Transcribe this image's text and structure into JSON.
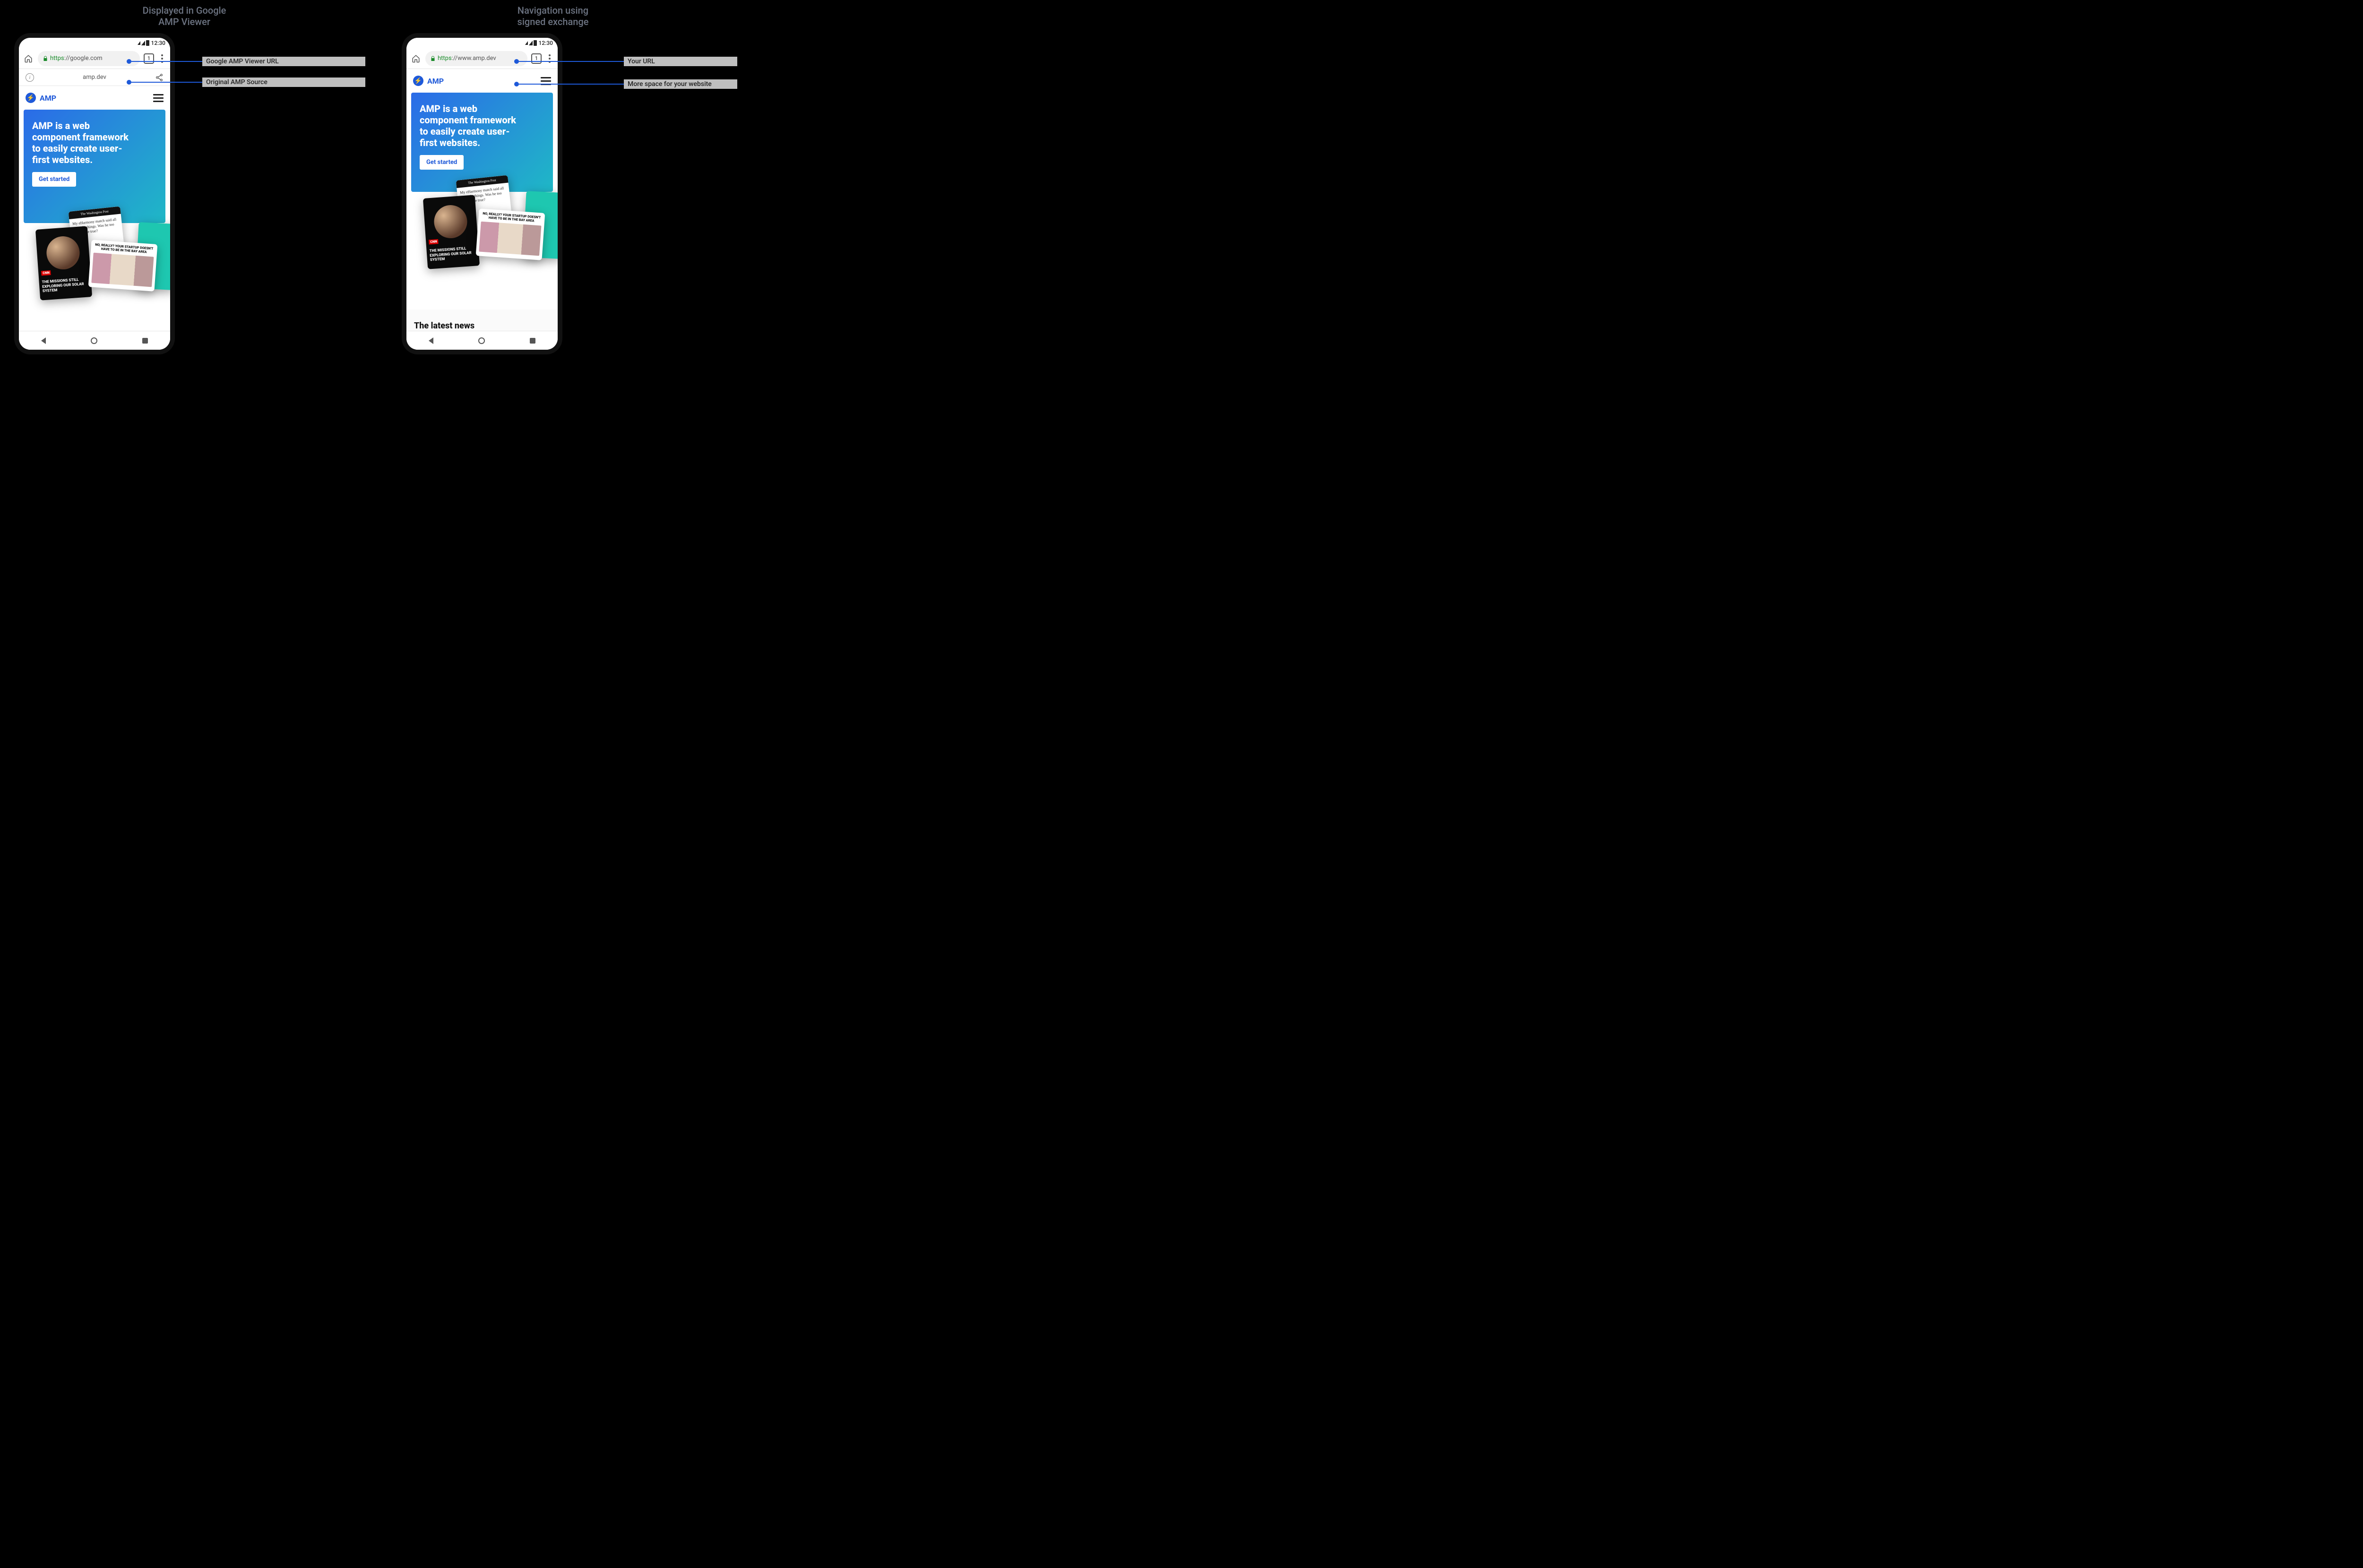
{
  "left": {
    "title": "Displayed in Google\nAMP Viewer",
    "status_time": "12:30",
    "url_https": "https",
    "url_rest": "://google.com",
    "tab_count": "1",
    "amp_source": "amp.dev",
    "amp_brand": "AMP",
    "hero_headline": "AMP is a web component framework to easily create user-first websites.",
    "hero_cta": "Get started",
    "wp_masthead": "The Washington Post",
    "wp_snippet": "My eHarmony match said all the right things. Was he too good to be true?",
    "cnn_tag": "CNN",
    "cnn_title": "THE MISSIONS STILL EXPLORING OUR SOLAR SYSTEM",
    "photo_title": "NO, REALLY? YOUR STARTUP DOESN'T HAVE TO BE IN THE BAY AREA",
    "anno1": "Google AMP Viewer URL",
    "anno2": "Original AMP Source"
  },
  "right": {
    "title": "Navigation using\nsigned exchange",
    "status_time": "12:30",
    "url_https": "https",
    "url_rest": "://www.amp.dev",
    "tab_count": "1",
    "amp_brand": "AMP",
    "hero_headline": "AMP is a web component framework to easily create user-first websites.",
    "hero_cta": "Get started",
    "wp_masthead": "The Washington Post",
    "wp_snippet": "My eHarmony match said all the right things. Was he too good to be true?",
    "cnn_tag": "CNN",
    "cnn_title": "THE MISSIONS STILL EXPLORING OUR SOLAR SYSTEM",
    "photo_title": "NO, REALLY? YOUR STARTUP DOESN'T HAVE TO BE IN THE BAY AREA",
    "latest_news": "The latest news",
    "anno1": "Your URL",
    "anno2": "More space for your website"
  }
}
